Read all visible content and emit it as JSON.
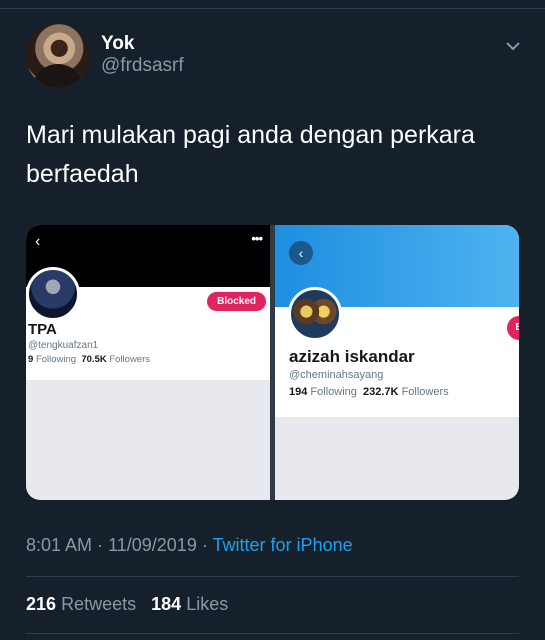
{
  "tweet": {
    "display_name": "Yok",
    "handle": "@frdsasrf",
    "text": "Mari mulakan pagi anda dengan perkara berfaedah",
    "time": "8:01 AM",
    "date": "11/09/2019",
    "separator": "·",
    "source": "Twitter for iPhone",
    "retweets_count": "216",
    "retweets_label": "Retweets",
    "likes_count": "184",
    "likes_label": "Likes"
  },
  "media": {
    "left": {
      "back_glyph": "‹",
      "more_glyph": "•••",
      "blocked_label": "Blocked",
      "name": "TPA",
      "handle": "@tengkuafzan1",
      "following_count": "9",
      "following_label": "Following",
      "followers_count": "70.5K",
      "followers_label": "Followers"
    },
    "right": {
      "back_glyph": "‹",
      "button_glyph": "B",
      "name": "azizah iskandar",
      "handle": "@cheminahsayang",
      "following_count": "194",
      "following_label": "Following",
      "followers_count": "232.7K",
      "followers_label": "Followers"
    }
  },
  "icons": {
    "caret": "chevron-down-icon"
  },
  "colors": {
    "background": "#15202b",
    "secondary_text": "#8899a6",
    "link": "#1da1f2",
    "blocked": "#e0245e"
  }
}
